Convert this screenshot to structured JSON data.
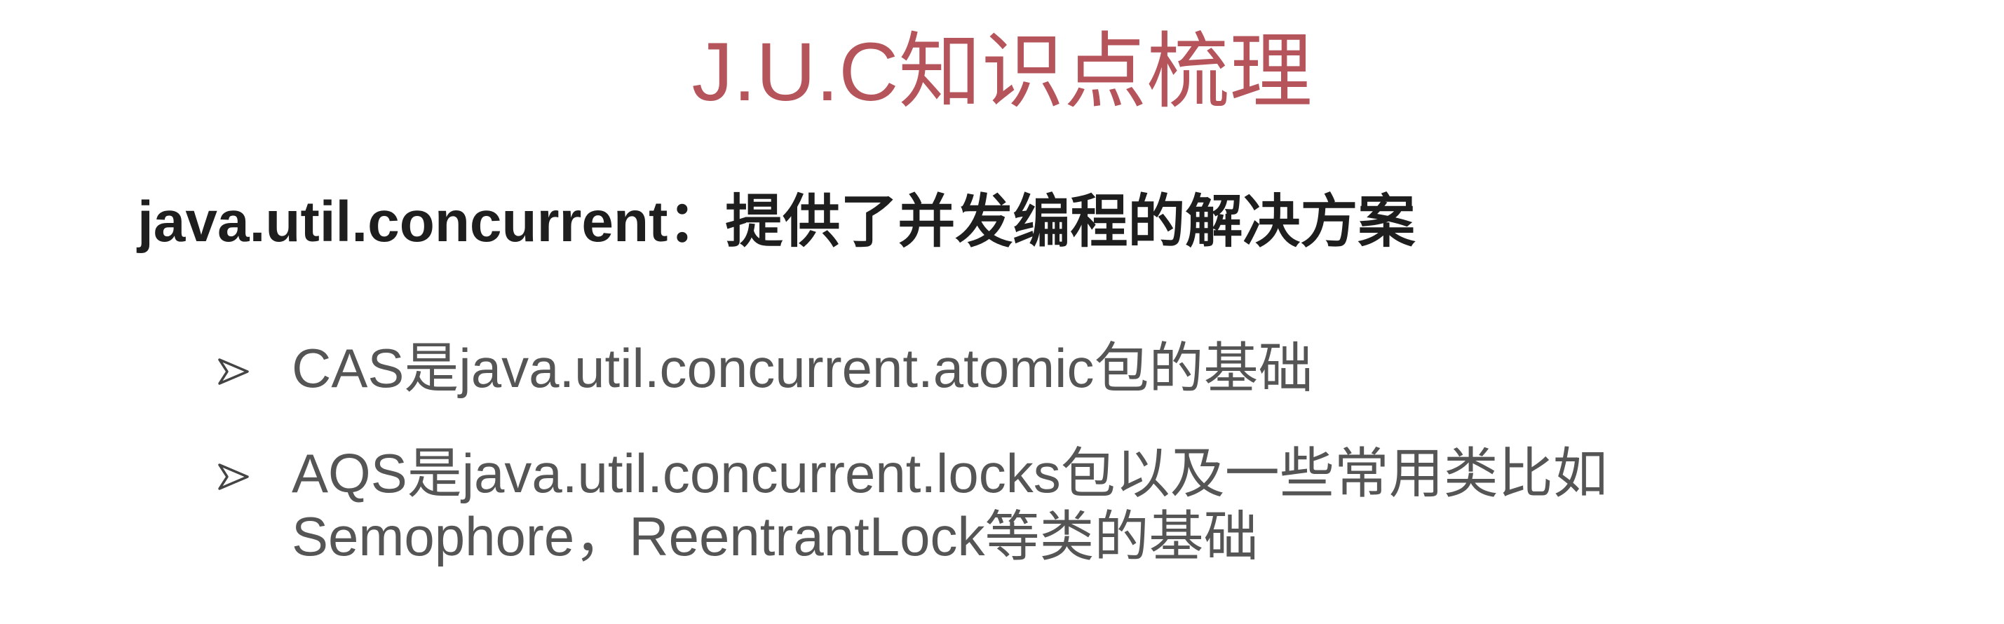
{
  "slide": {
    "title": "J.U.C知识点梳理",
    "subtitle": "java.util.concurrent：提供了并发编程的解决方案",
    "bullet_icon": "triangle-arrow-bullet-icon",
    "colors": {
      "title": "#b5545a",
      "subtitle": "#1e1e1e",
      "body": "#555555"
    },
    "bullets": [
      {
        "lines": [
          "CAS是java.util.concurrent.atomic包的基础"
        ]
      },
      {
        "lines": [
          "AQS是java.util.concurrent.locks包以及一些常用类比如",
          "Semophore，ReentrantLock等类的基础"
        ]
      }
    ]
  }
}
